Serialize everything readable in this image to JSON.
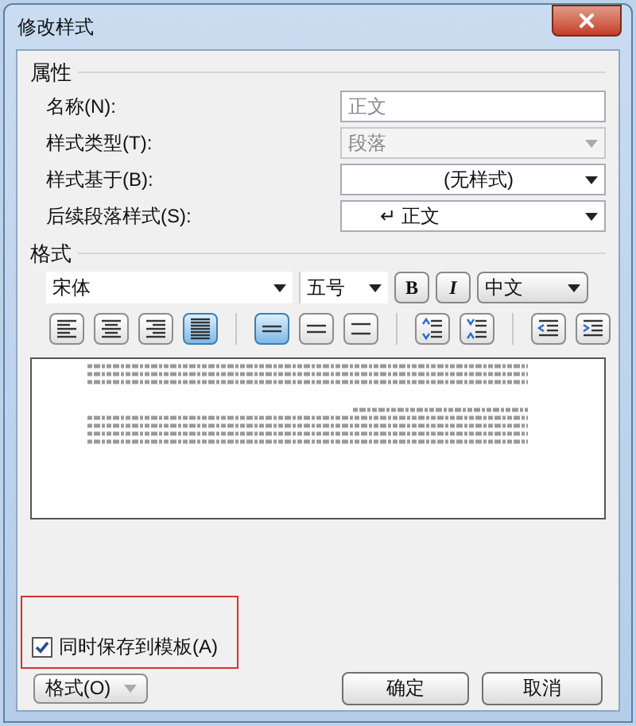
{
  "window": {
    "title": "修改样式"
  },
  "properties": {
    "heading": "属性",
    "fields": [
      {
        "label": "名称(N):",
        "value": "正文",
        "kind": "text",
        "disabled": false
      },
      {
        "label": "样式类型(T):",
        "value": "段落",
        "kind": "select",
        "disabled": true
      },
      {
        "label": "样式基于(B):",
        "value": "(无样式)",
        "kind": "select",
        "disabled": false
      },
      {
        "label": "后续段落样式(S):",
        "value": "↵ 正文",
        "kind": "select",
        "disabled": false
      }
    ]
  },
  "format": {
    "heading": "格式",
    "font": "宋体",
    "size": "五号",
    "bold": {
      "label": "B",
      "selected": false
    },
    "italic": {
      "label": "I",
      "selected": false
    },
    "script": "中文",
    "tools": [
      {
        "kind": "align-left",
        "selected": false,
        "group_start": false
      },
      {
        "kind": "align-center",
        "selected": false,
        "group_start": false
      },
      {
        "kind": "align-right",
        "selected": false,
        "group_start": false
      },
      {
        "kind": "align-justify",
        "selected": true,
        "group_start": false
      },
      {
        "kind": "spacing-single",
        "selected": true,
        "group_start": true
      },
      {
        "kind": "spacing-mid",
        "selected": false,
        "group_start": false
      },
      {
        "kind": "spacing-double",
        "selected": false,
        "group_start": false
      },
      {
        "kind": "space-increase",
        "selected": false,
        "group_start": true
      },
      {
        "kind": "space-decrease",
        "selected": false,
        "group_start": false
      },
      {
        "kind": "indent-decrease",
        "selected": false,
        "group_start": true
      },
      {
        "kind": "indent-increase",
        "selected": false,
        "group_start": false
      }
    ]
  },
  "save_to_template": {
    "label": "同时保存到模板(A)",
    "checked": true
  },
  "buttons": {
    "format_menu": "格式(O)",
    "ok": "确定",
    "cancel": "取消"
  }
}
